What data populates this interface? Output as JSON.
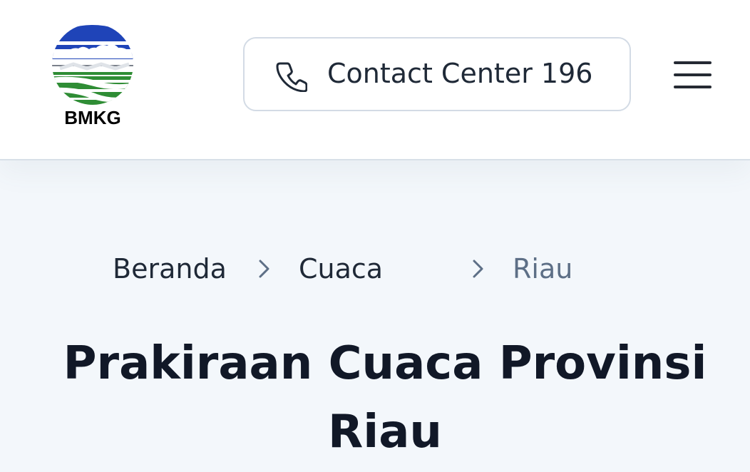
{
  "header": {
    "logo": {
      "text": "BMKG",
      "colors": {
        "blue": "#1f44b8",
        "green": "#2f8d35",
        "gray": "#cfd4dc"
      }
    },
    "contact_button": {
      "label": "Contact Center 196",
      "icon": "phone-icon"
    },
    "menu_button": {
      "icon": "menu-icon"
    }
  },
  "breadcrumb": {
    "items": [
      {
        "label": "Beranda"
      },
      {
        "label": "Cuaca"
      },
      {
        "label": "Riau"
      }
    ],
    "separator_icon": "chevron-right-icon"
  },
  "page": {
    "title_line_1": "Prakiraan Cuaca Provinsi",
    "title_line_2": "Riau"
  },
  "colors": {
    "header_background": "#ffffff",
    "page_background": "#f3f7fb",
    "text_primary": "#111827",
    "text_secondary": "#5d6f86",
    "button_border": "#d3dbe5"
  }
}
